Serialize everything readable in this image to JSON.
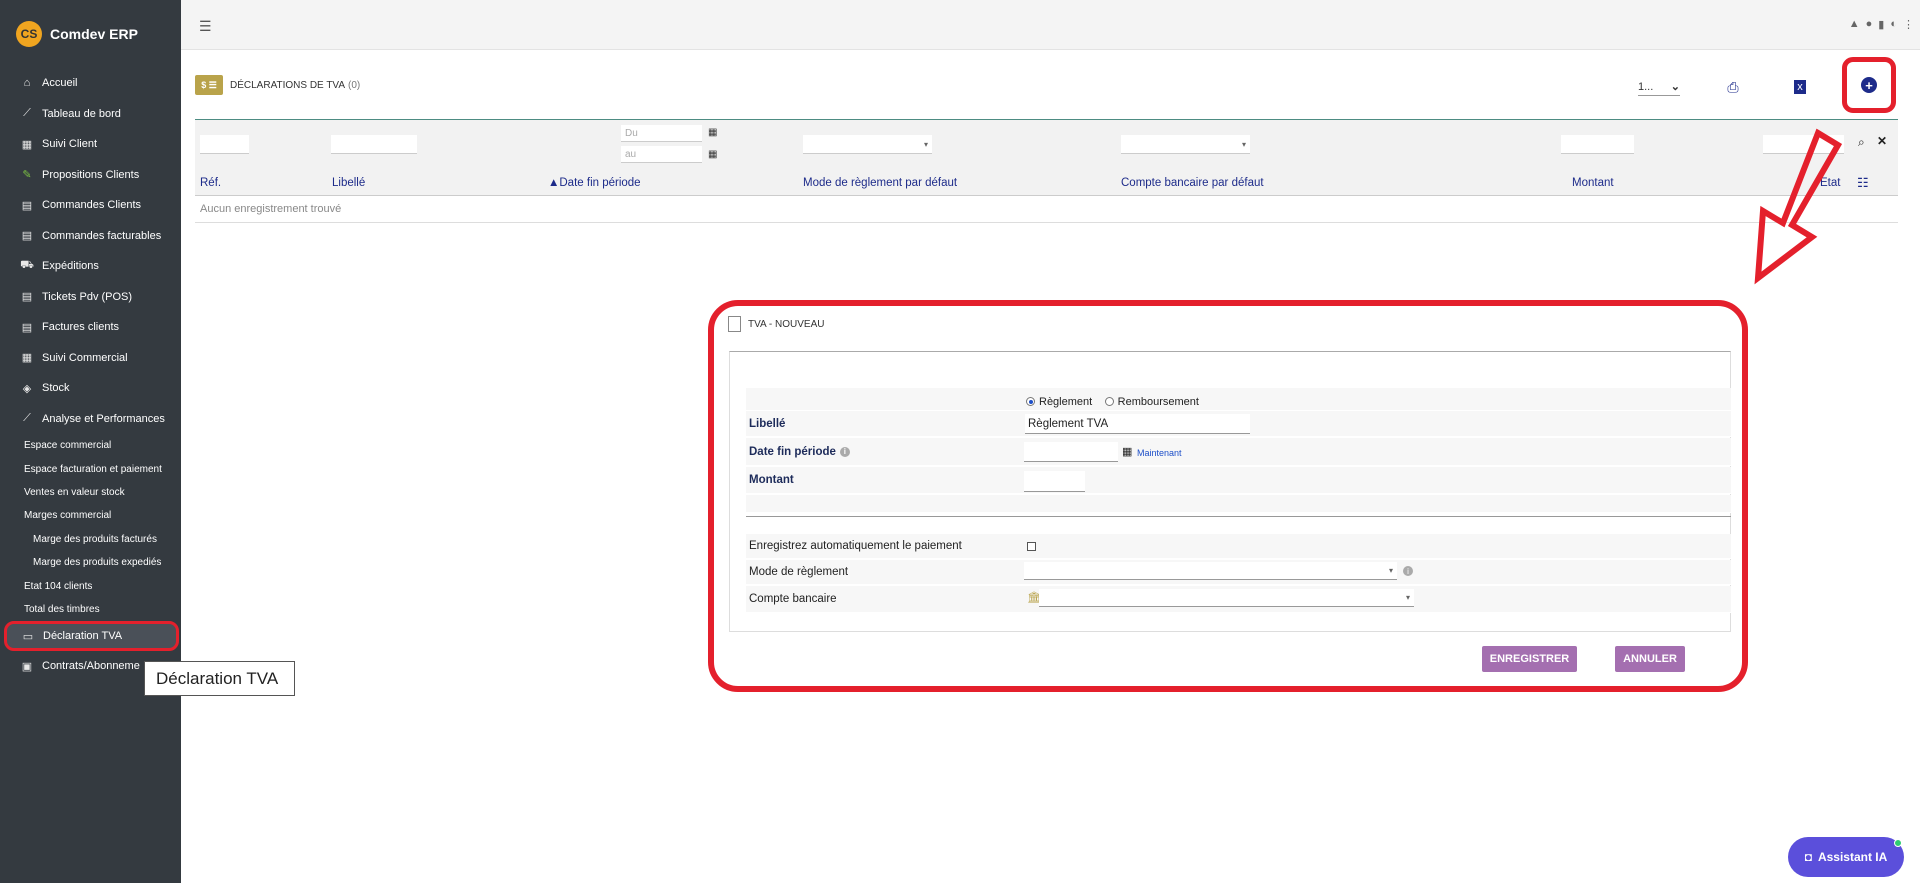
{
  "brand": {
    "name": "Comdev ERP",
    "logo_text": "CS"
  },
  "sidebar": {
    "items": [
      {
        "label": "Accueil",
        "icon": "home-icon",
        "glyph": "⌂"
      },
      {
        "label": "Tableau de bord",
        "icon": "chart-line-icon",
        "glyph": "📈"
      },
      {
        "label": "Suivi Client",
        "icon": "building-icon",
        "glyph": "▦"
      },
      {
        "label": "Propositions Clients",
        "icon": "signature-icon",
        "glyph": "✎"
      },
      {
        "label": "Commandes Clients",
        "icon": "file-icon",
        "glyph": "▤"
      },
      {
        "label": "Commandes facturables",
        "icon": "file-icon",
        "glyph": "▤"
      },
      {
        "label": "Expéditions",
        "icon": "dolly-icon",
        "glyph": "⛟"
      },
      {
        "label": "Tickets Pdv (POS)",
        "icon": "file-icon",
        "glyph": "▤"
      },
      {
        "label": "Factures clients",
        "icon": "file-icon",
        "glyph": "▤"
      },
      {
        "label": "Suivi Commercial",
        "icon": "building-icon",
        "glyph": "▦"
      },
      {
        "label": "Stock",
        "icon": "box-icon",
        "glyph": "◈"
      },
      {
        "label": "Analyse et Performances",
        "icon": "chart-line-icon",
        "glyph": "📈"
      }
    ],
    "subitems": [
      {
        "label": "Espace commercial",
        "level": 1
      },
      {
        "label": "Espace facturation et paiement",
        "level": 1
      },
      {
        "label": "Ventes en valeur stock",
        "level": 1
      },
      {
        "label": "Marges commercial",
        "level": 1
      },
      {
        "label": "Marge des produits facturés",
        "level": 2
      },
      {
        "label": "Marge des produits expediés",
        "level": 2
      },
      {
        "label": "Etat 104 clients",
        "level": 1
      },
      {
        "label": "Total des timbres",
        "level": 1
      }
    ],
    "active_item": {
      "label": "Déclaration TVA",
      "icon": "money-check-icon"
    },
    "last_item": {
      "label": "Contrats/Abonneme",
      "icon": "briefcase-icon"
    },
    "tooltip": "Déclaration TVA"
  },
  "header": {
    "title": "DÉCLARATIONS DE TVA",
    "count": "(0)",
    "icon_text": "$ ☰"
  },
  "toolbar": {
    "page_size": "1...",
    "print_icon": "print-icon",
    "excel_icon": "file-excel-icon",
    "add_icon": "plus-circle-icon"
  },
  "filters": {
    "date_from_placeholder": "Du",
    "date_to_placeholder": "au"
  },
  "table": {
    "columns": [
      "Réf.",
      "Libellé",
      "▲Date fin période",
      "Mode de règlement par défaut",
      "Compte bancaire par défaut",
      "Montant",
      "Etat"
    ],
    "empty_message": "Aucun enregistrement trouvé"
  },
  "modal": {
    "title": "TVA - NOUVEAU",
    "radio_options": [
      "Règlement",
      "Remboursement"
    ],
    "selected_radio": "Règlement",
    "fields": {
      "libelle_label": "Libellé",
      "libelle_value": "Règlement TVA",
      "date_label": "Date fin période",
      "now_link": "Maintenant",
      "montant_label": "Montant",
      "auto_payment_label": "Enregistrez automatiquement le paiement",
      "payment_mode_label": "Mode de règlement",
      "bank_account_label": "Compte bancaire"
    },
    "save_button": "ENREGISTRER",
    "cancel_button": "ANNULER"
  },
  "assistant": {
    "label": "Assistant IA"
  },
  "colors": {
    "sidebar_bg": "#343a40",
    "accent_blue": "#1d2b8a",
    "highlight_red": "#e4202c",
    "button_purple": "#a46fb0",
    "assistant_bg": "#5b4fdb"
  }
}
